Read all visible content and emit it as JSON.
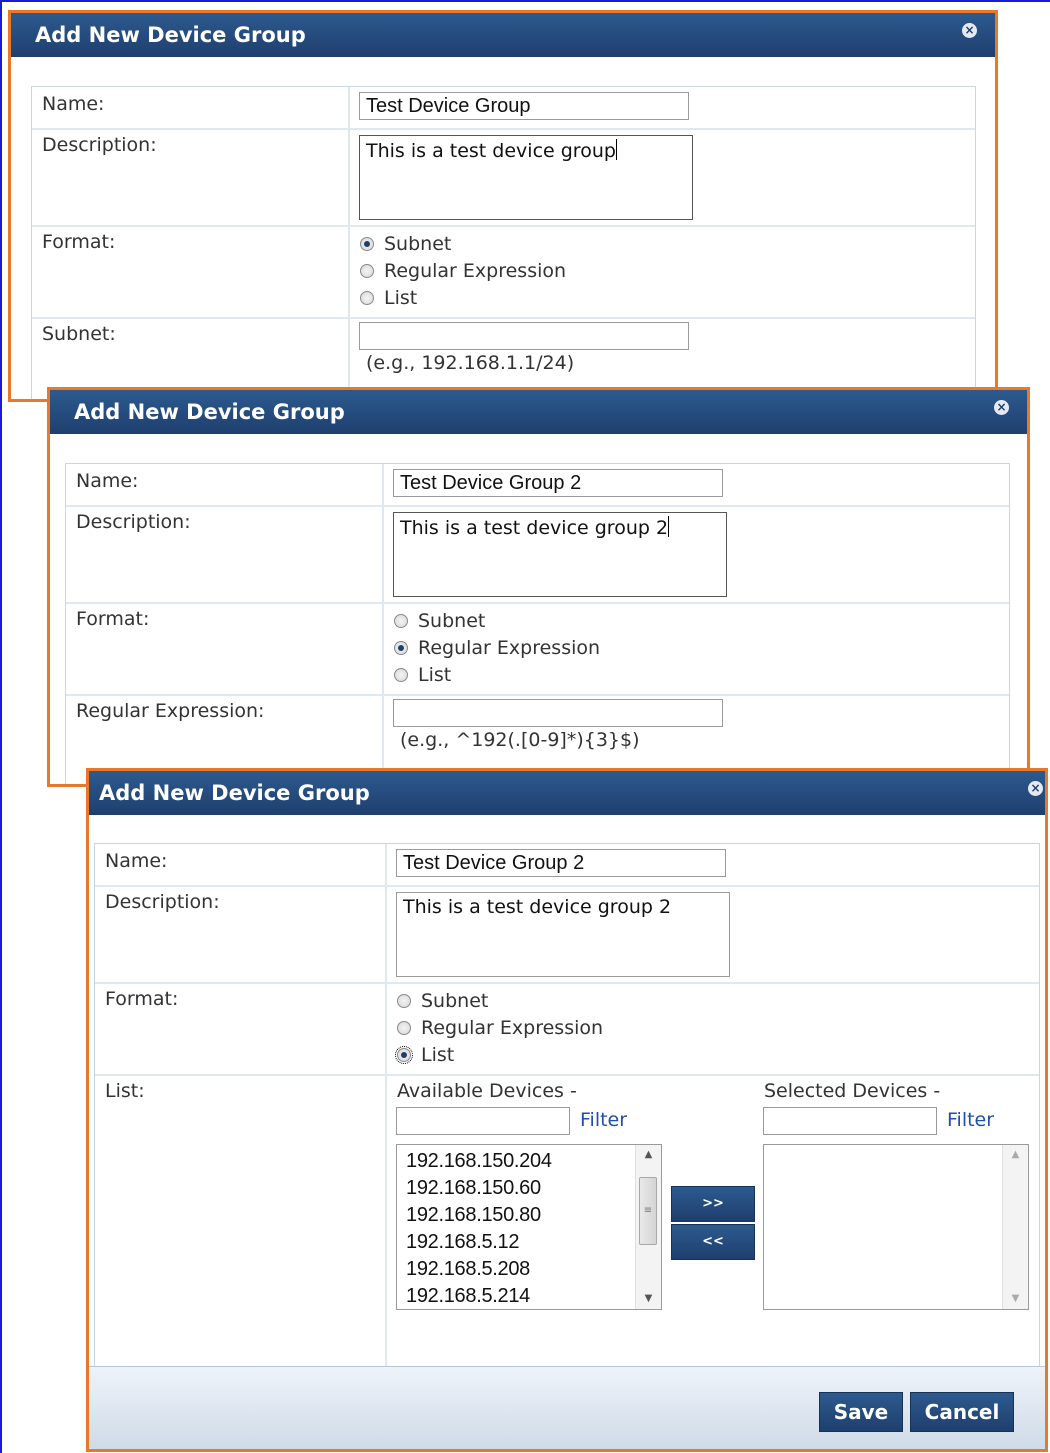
{
  "dialogs": [
    {
      "title": "Add New Device Group",
      "name_label": "Name:",
      "name_value": "Test Device Group",
      "description_label": "Description:",
      "description_value": "This is a test device group",
      "format_label": "Format:",
      "format_options": [
        "Subnet",
        "Regular Expression",
        "List"
      ],
      "format_selected": "Subnet",
      "field_label": "Subnet:",
      "field_value": "",
      "field_hint": "(e.g., 192.168.1.1/24)"
    },
    {
      "title": "Add New Device Group",
      "name_label": "Name:",
      "name_value": "Test Device Group 2",
      "description_label": "Description:",
      "description_value": "This is a test device group 2",
      "format_label": "Format:",
      "format_options": [
        "Subnet",
        "Regular Expression",
        "List"
      ],
      "format_selected": "Regular Expression",
      "field_label": "Regular Expression:",
      "field_value": "",
      "field_hint": "(e.g., ^192(.[0-9]*){3}$)"
    },
    {
      "title": "Add New Device Group",
      "name_label": "Name:",
      "name_value": "Test Device Group 2",
      "description_label": "Description:",
      "description_value": "This is a test device group 2",
      "format_label": "Format:",
      "format_options": [
        "Subnet",
        "Regular Expression",
        "List"
      ],
      "format_selected": "List",
      "field_label": "List:",
      "available_devices_label": "Available Devices -",
      "selected_devices_label": "Selected Devices -",
      "filter_label": "Filter",
      "available_devices": [
        "192.168.150.204",
        "192.168.150.60",
        "192.168.150.80",
        "192.168.5.12",
        "192.168.5.208",
        "192.168.5.214"
      ],
      "selected_devices": [],
      "add_button": ">>",
      "remove_button": "<<",
      "save_button": "Save",
      "cancel_button": "Cancel"
    }
  ],
  "colors": {
    "dialog_border": "#e8782a",
    "titlebar": "#1e3f6e",
    "page_frame": "#1a1ad6",
    "link": "#1f4fa8"
  }
}
